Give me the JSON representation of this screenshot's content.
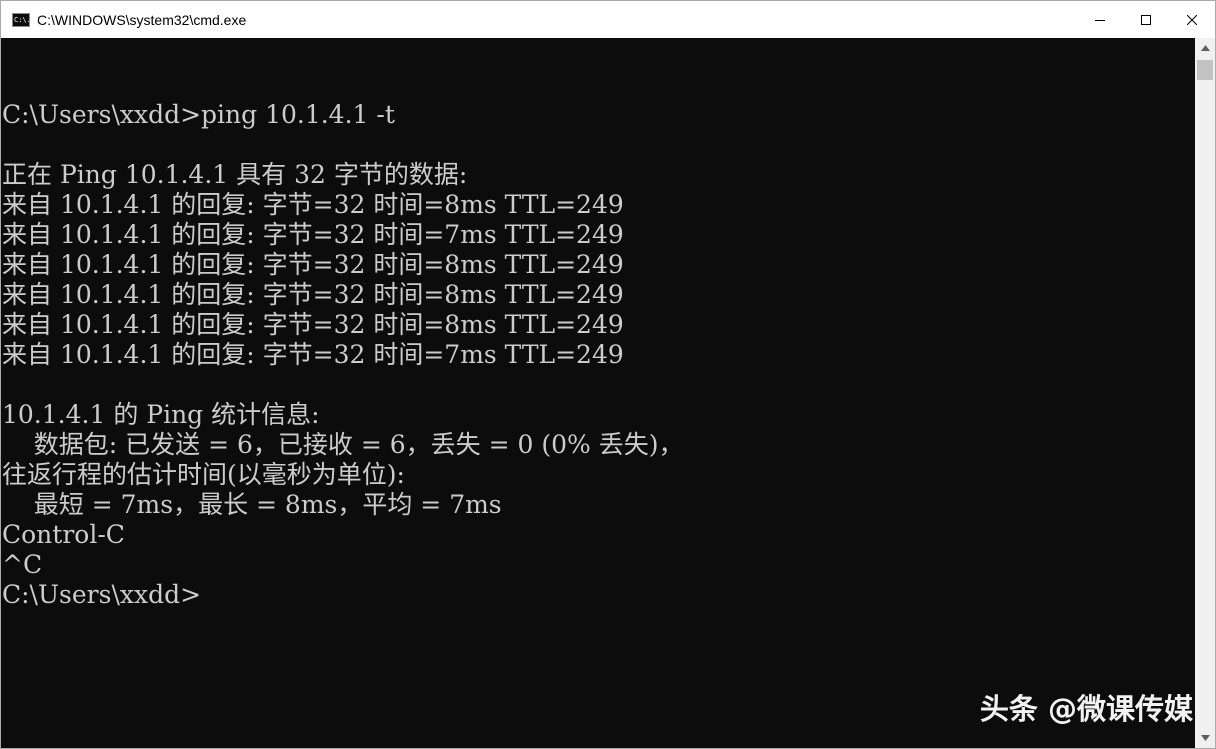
{
  "window": {
    "title": "C:\\WINDOWS\\system32\\cmd.exe",
    "icon": "cmd-icon",
    "icon_text": "C:\\."
  },
  "controls": {
    "minimize_icon": "minimize-icon",
    "maximize_icon": "maximize-icon",
    "close_icon": "close-icon"
  },
  "console": {
    "lines": [
      "",
      "C:\\Users\\xxdd>ping 10.1.4.1 -t",
      "",
      "正在 Ping 10.1.4.1 具有 32 字节的数据:",
      "来自 10.1.4.1 的回复: 字节=32 时间=8ms TTL=249",
      "来自 10.1.4.1 的回复: 字节=32 时间=7ms TTL=249",
      "来自 10.1.4.1 的回复: 字节=32 时间=8ms TTL=249",
      "来自 10.1.4.1 的回复: 字节=32 时间=8ms TTL=249",
      "来自 10.1.4.1 的回复: 字节=32 时间=8ms TTL=249",
      "来自 10.1.4.1 的回复: 字节=32 时间=7ms TTL=249",
      "",
      "10.1.4.1 的 Ping 统计信息:",
      "    数据包: 已发送 = 6，已接收 = 6，丢失 = 0 (0% 丢失)，",
      "往返行程的估计时间(以毫秒为单位):",
      "    最短 = 7ms，最长 = 8ms，平均 = 7ms",
      "Control-C",
      "^C",
      "C:\\Users\\xxdd>"
    ],
    "text_color": "#cccccc",
    "background": "#0c0c0c"
  },
  "scrollbar": {
    "up_icon": "scroll-up-arrow-icon",
    "down_icon": "scroll-down-arrow-icon"
  },
  "watermark": {
    "text": "头条 @微课传媒"
  }
}
